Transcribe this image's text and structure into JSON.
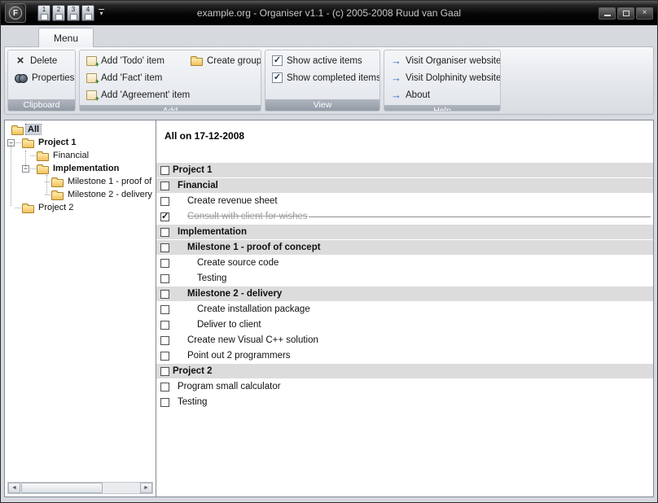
{
  "window": {
    "title": "example.org - Organiser v1.1 - (c) 2005-2008 Ruud van Gaal",
    "app_icon_letter": "F",
    "quick_access_buttons": [
      "1",
      "2",
      "3",
      "4"
    ]
  },
  "icons": {
    "close": "×",
    "delete_x": "×",
    "qat_dropdown": "▾",
    "help_arrow": "→",
    "scroll_left": "◄",
    "scroll_right": "►"
  },
  "tab": {
    "label": "Menu"
  },
  "ribbon": {
    "clipboard": {
      "label": "Clipboard",
      "delete": "Delete",
      "properties": "Properties"
    },
    "add": {
      "label": "Add",
      "todo": "Add 'Todo' item",
      "fact": "Add 'Fact' item",
      "agreement": "Add 'Agreement' item",
      "create_group": "Create group"
    },
    "view": {
      "label": "View",
      "active": {
        "label": "Show active items",
        "check": "✓"
      },
      "completed": {
        "label": "Show completed items",
        "check": "✓"
      }
    },
    "help": {
      "label": "Help",
      "items": [
        "Visit Organiser website",
        "Visit Dolphinity website",
        "About"
      ]
    }
  },
  "tree": {
    "items": [
      {
        "label": "All"
      },
      {
        "label": "Project 1",
        "expander": "−"
      },
      {
        "label": "Financial"
      },
      {
        "label": "Implementation",
        "expander": "−"
      },
      {
        "label": "Milestone 1 - proof of"
      },
      {
        "label": "Milestone 2 - delivery"
      },
      {
        "label": "Project 2"
      }
    ]
  },
  "main": {
    "header": "All on 17-12-2008",
    "rows": [
      {
        "label": "Project 1",
        "check": ""
      },
      {
        "label": "Financial",
        "check": ""
      },
      {
        "label": "Create revenue sheet",
        "check": ""
      },
      {
        "label": "Consult with client for wishes",
        "check": "✓"
      },
      {
        "label": "Implementation",
        "check": ""
      },
      {
        "label": "Milestone 1 - proof of concept",
        "check": ""
      },
      {
        "label": "Create source code",
        "check": ""
      },
      {
        "label": "Testing",
        "check": ""
      },
      {
        "label": "Milestone 2 - delivery",
        "check": ""
      },
      {
        "label": "Create installation package",
        "check": ""
      },
      {
        "label": "Deliver to client",
        "check": ""
      },
      {
        "label": "Create new Visual C++ solution",
        "check": ""
      },
      {
        "label": "Point out 2 programmers",
        "check": ""
      },
      {
        "label": "Project 2",
        "check": ""
      },
      {
        "label": "Program small calculator",
        "check": ""
      },
      {
        "label": "Testing",
        "check": ""
      }
    ]
  }
}
